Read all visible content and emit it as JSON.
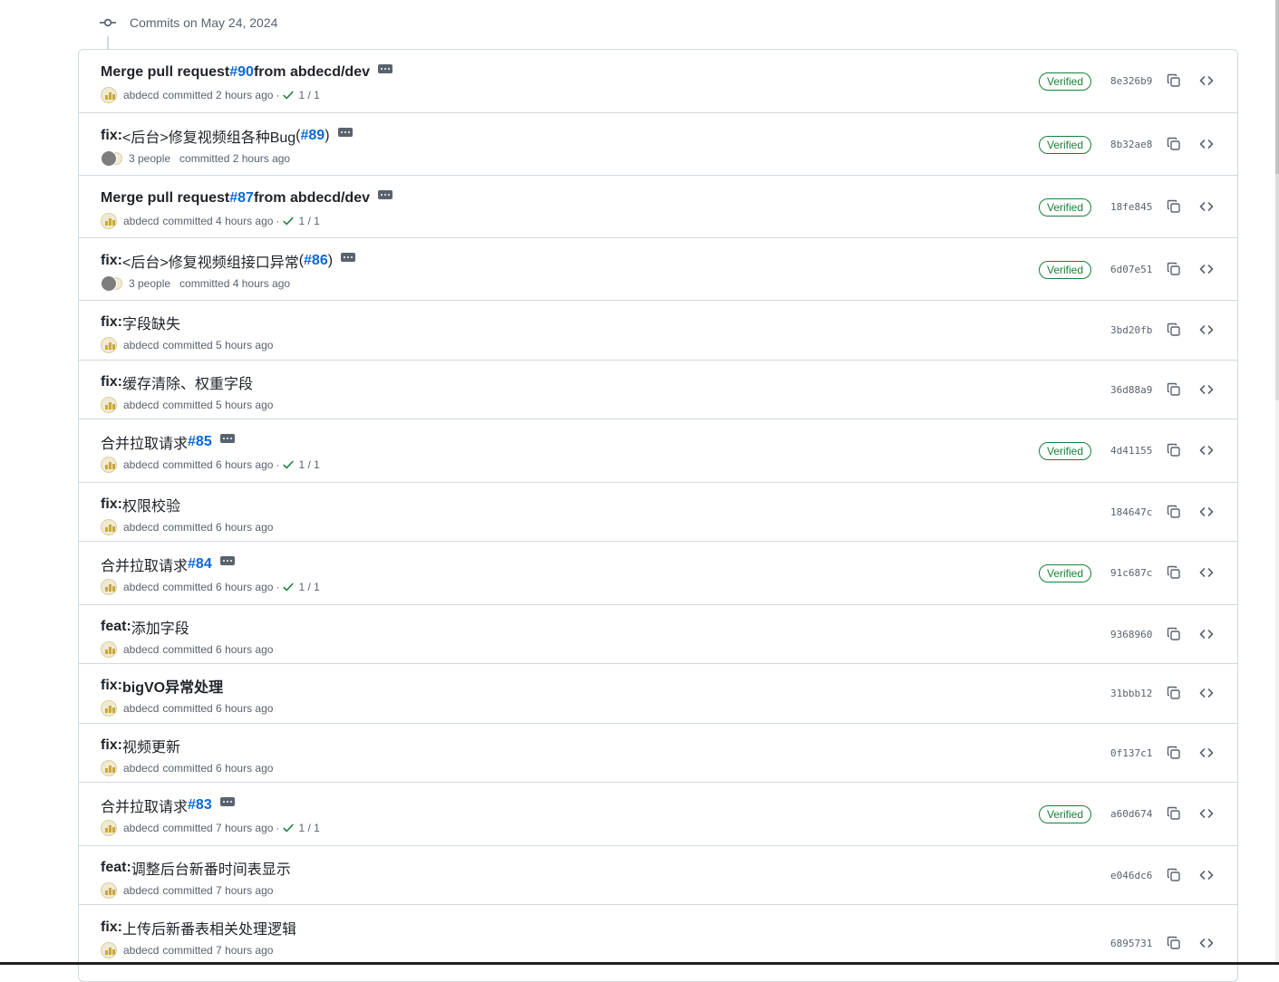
{
  "group": {
    "title": "Commits on May 24, 2024"
  },
  "commits": [
    {
      "prefix": "Merge pull request ",
      "rest": "",
      "pr": "#90",
      "suffix": " from abdecd/dev",
      "has_ellipsis": true,
      "author": "abdecd",
      "multi": false,
      "action": "committed 2 hours ago",
      "checks": "1 / 1",
      "verified": true,
      "sha": "8e326b9"
    },
    {
      "prefix": "fix: ",
      "rest": "<后台>修复视频组各种Bug ",
      "paren_open": "(",
      "pr": "#89",
      "paren_close": ")",
      "has_ellipsis": true,
      "author": "3 people",
      "multi": true,
      "action": "committed 2 hours ago",
      "checks": "",
      "verified": true,
      "sha": "8b32ae8"
    },
    {
      "prefix": "Merge pull request ",
      "rest": "",
      "pr": "#87",
      "suffix": " from abdecd/dev",
      "has_ellipsis": true,
      "author": "abdecd",
      "multi": false,
      "action": "committed 4 hours ago",
      "checks": "1 / 1",
      "verified": true,
      "sha": "18fe845"
    },
    {
      "prefix": "fix: ",
      "rest": "<后台>修复视频组接口异常 ",
      "paren_open": "(",
      "pr": "#86",
      "paren_close": ")",
      "has_ellipsis": true,
      "author": "3 people",
      "multi": true,
      "action": "committed 4 hours ago",
      "checks": "",
      "verified": true,
      "sha": "6d07e51"
    },
    {
      "prefix": "fix: ",
      "rest": "字段缺失",
      "pr": "",
      "has_ellipsis": false,
      "author": "abdecd",
      "multi": false,
      "action": "committed 5 hours ago",
      "checks": "",
      "verified": false,
      "sha": "3bd20fb"
    },
    {
      "prefix": "fix: ",
      "rest": "缓存清除、权重字段",
      "pr": "",
      "has_ellipsis": false,
      "author": "abdecd",
      "multi": false,
      "action": "committed 5 hours ago",
      "checks": "",
      "verified": false,
      "sha": "36d88a9"
    },
    {
      "prefix": "",
      "rest": "合并拉取请求 ",
      "pr": "#85",
      "has_ellipsis": true,
      "author": "abdecd",
      "multi": false,
      "action": "committed 6 hours ago",
      "checks": "1 / 1",
      "verified": true,
      "sha": "4d41155"
    },
    {
      "prefix": "fix: ",
      "rest": "权限校验",
      "pr": "",
      "has_ellipsis": false,
      "author": "abdecd",
      "multi": false,
      "action": "committed 6 hours ago",
      "checks": "",
      "verified": false,
      "sha": "184647c"
    },
    {
      "prefix": "",
      "rest": "合并拉取请求 ",
      "pr": "#84",
      "has_ellipsis": true,
      "author": "abdecd",
      "multi": false,
      "action": "committed 6 hours ago",
      "checks": "1 / 1",
      "verified": true,
      "sha": "91c687c"
    },
    {
      "prefix": "feat: ",
      "rest": "添加字段",
      "pr": "",
      "has_ellipsis": false,
      "author": "abdecd",
      "multi": false,
      "action": "committed 6 hours ago",
      "checks": "",
      "verified": false,
      "sha": "9368960"
    },
    {
      "prefix": "fix: ",
      "rest": "bigVO异常处理",
      "rest_bold": true,
      "pr": "",
      "has_ellipsis": false,
      "author": "abdecd",
      "multi": false,
      "action": "committed 6 hours ago",
      "checks": "",
      "verified": false,
      "sha": "31bbb12"
    },
    {
      "prefix": "fix: ",
      "rest": "视频更新",
      "pr": "",
      "has_ellipsis": false,
      "author": "abdecd",
      "multi": false,
      "action": "committed 6 hours ago",
      "checks": "",
      "verified": false,
      "sha": "0f137c1"
    },
    {
      "prefix": "",
      "rest": "合并拉取请求 ",
      "pr": "#83",
      "has_ellipsis": true,
      "author": "abdecd",
      "multi": false,
      "action": "committed 7 hours ago",
      "checks": "1 / 1",
      "verified": true,
      "sha": "a60d674"
    },
    {
      "prefix": "feat: ",
      "rest": "调整后台新番时间表显示",
      "pr": "",
      "has_ellipsis": false,
      "author": "abdecd",
      "multi": false,
      "action": "committed 7 hours ago",
      "checks": "",
      "verified": false,
      "sha": "e046dc6"
    },
    {
      "prefix": "fix: ",
      "rest": "上传后新番表相关处理逻辑",
      "pr": "",
      "has_ellipsis": false,
      "author": "abdecd",
      "multi": false,
      "action": "committed 7 hours ago",
      "checks": "",
      "verified": false,
      "sha": "6895731"
    }
  ],
  "labels": {
    "verified": "Verified",
    "meta_separator": "·"
  },
  "icons": {
    "group_icon": "git-commit-icon",
    "copy": "copy-icon",
    "browse": "code-icon",
    "check": "check-icon",
    "ellipsis": "ellipsis-icon"
  },
  "colors": {
    "link": "#0969da",
    "verified": "#1a7f37",
    "muted": "#59636e",
    "border": "#d1d9e0"
  }
}
